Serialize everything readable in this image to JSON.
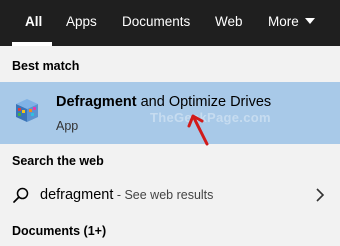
{
  "tabs": [
    {
      "label": "All",
      "active": true
    },
    {
      "label": "Apps",
      "active": false
    },
    {
      "label": "Documents",
      "active": false
    },
    {
      "label": "Web",
      "active": false
    },
    {
      "label": "More",
      "active": false
    }
  ],
  "best_match": {
    "heading": "Best match",
    "title_bold": "Defragment",
    "title_rest": " and Optimize Drives",
    "subtitle": "App",
    "icon": "defragment-app-icon",
    "watermark": "TheGeekPage.com"
  },
  "search_web": {
    "heading": "Search the web",
    "query": "defragment",
    "hint": " - See web results",
    "icon": "search-icon"
  },
  "documents": {
    "label": "Documents (1+)"
  },
  "colors": {
    "topbar": "#1f1f1f",
    "background": "#f2f2f2",
    "selection": "#a8c9e8",
    "annotation_arrow": "#d11a1a"
  }
}
